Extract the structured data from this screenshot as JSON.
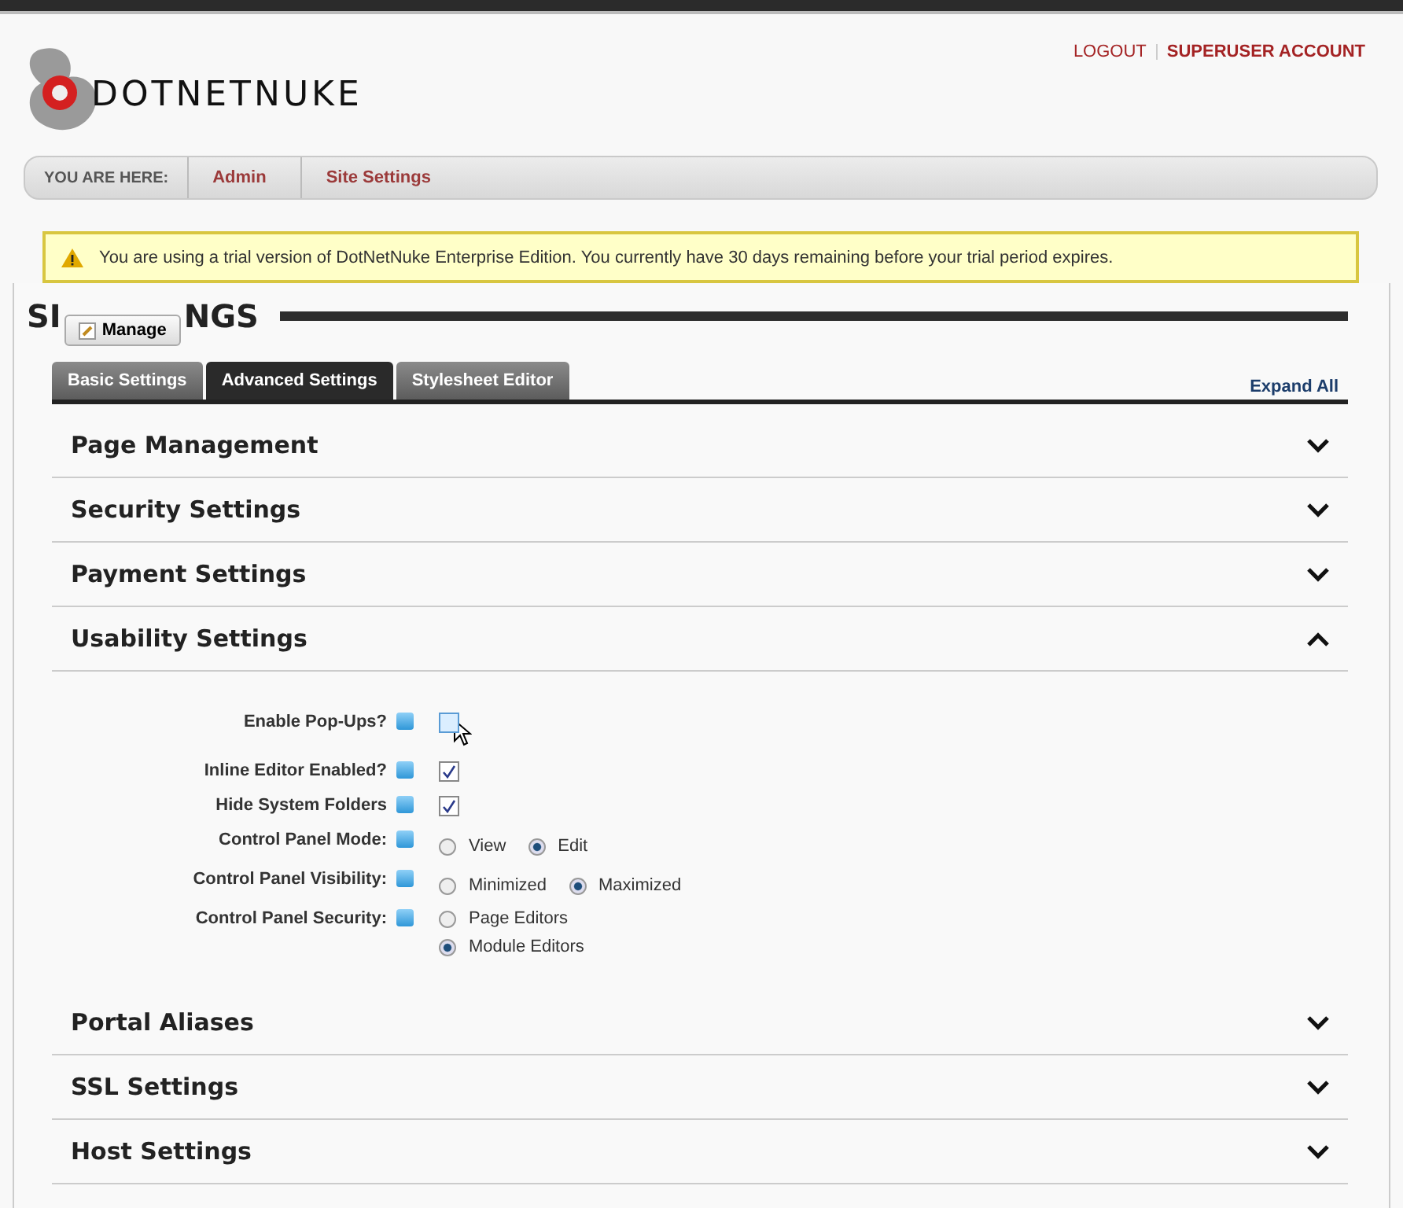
{
  "header": {
    "logo_text": "DOTNETNUKE",
    "links": [
      "LOGOUT",
      "SUPERUSER ACCOUNT"
    ]
  },
  "breadcrumb": {
    "label": "YOU ARE HERE:",
    "items": [
      "Admin",
      "Site Settings"
    ]
  },
  "warning": "You are using a trial version of DotNetNuke Enterprise Edition. You currently have 30 days remaining before your trial period expires.",
  "page_title_parts": [
    "SI",
    "NGS"
  ],
  "manage_button": "Manage",
  "tabs": [
    {
      "label": "Basic Settings",
      "selected": false
    },
    {
      "label": "Advanced Settings",
      "selected": true
    },
    {
      "label": "Stylesheet Editor",
      "selected": false
    }
  ],
  "expand_all": "Expand All",
  "sections": [
    {
      "title": "Page Management",
      "expanded": false
    },
    {
      "title": "Security Settings",
      "expanded": false
    },
    {
      "title": "Payment Settings",
      "expanded": false
    },
    {
      "title": "Usability Settings",
      "expanded": true,
      "fields": [
        {
          "label": "Enable Pop-Ups?",
          "kind": "checkbox",
          "checked": false,
          "hovered": true
        },
        {
          "label": "Inline Editor Enabled?",
          "kind": "checkbox",
          "checked": true,
          "hovered": false
        },
        {
          "label": "Hide System Folders",
          "kind": "checkbox",
          "checked": true,
          "hovered": false
        },
        {
          "label": "Control Panel Mode:",
          "kind": "radio",
          "stacked": false,
          "options": [
            {
              "label": "View",
              "selected": false
            },
            {
              "label": "Edit",
              "selected": true
            }
          ]
        },
        {
          "label": "Control Panel Visibility:",
          "kind": "radio",
          "stacked": false,
          "options": [
            {
              "label": "Minimized",
              "selected": false
            },
            {
              "label": "Maximized",
              "selected": true
            }
          ]
        },
        {
          "label": "Control Panel Security:",
          "kind": "radio",
          "stacked": true,
          "options": [
            {
              "label": "Page Editors",
              "selected": false
            },
            {
              "label": "Module Editors",
              "selected": true
            }
          ]
        }
      ]
    },
    {
      "title": "Portal Aliases",
      "expanded": false
    },
    {
      "title": "SSL Settings",
      "expanded": false
    },
    {
      "title": "Host Settings",
      "expanded": false
    }
  ]
}
